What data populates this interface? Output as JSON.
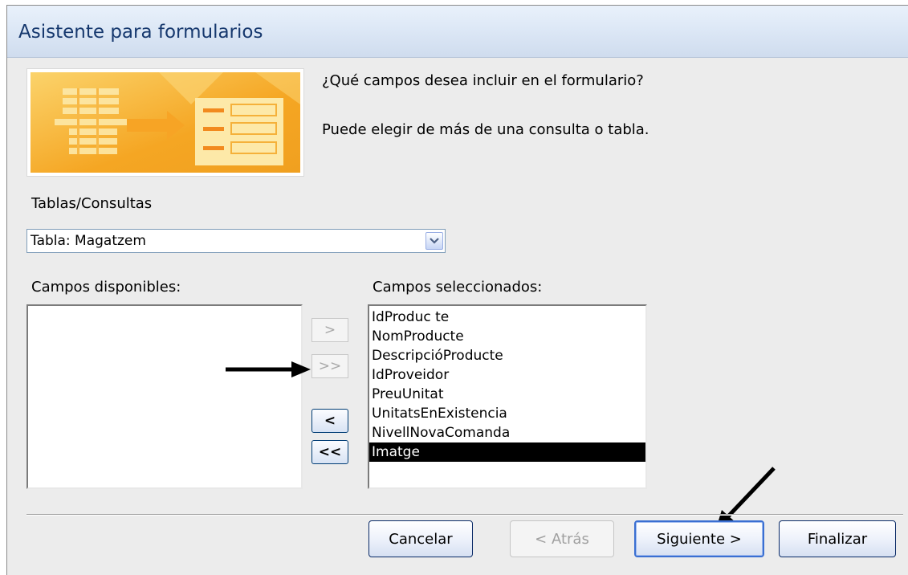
{
  "window": {
    "title": "Asistente para formularios"
  },
  "prompts": {
    "question": "¿Qué campos desea incluir en el formulario?",
    "hint": "Puede elegir de más de una consulta o tabla."
  },
  "tables_queries": {
    "label": "Tablas/Consultas",
    "selected": "Tabla: Magatzem"
  },
  "available_fields": {
    "label": "Campos disponibles:",
    "items": []
  },
  "selected_fields": {
    "label": "Campos seleccionados:",
    "items": [
      "IdProduc te",
      "NomProducte",
      "DescripcióProducte",
      "IdProveidor",
      "PreuUnitat",
      "UnitatsEnExistencia",
      "NivellNovaComanda",
      "Imatge"
    ],
    "highlighted": "Imatge"
  },
  "move_buttons": {
    "add_one": ">",
    "add_all": ">>",
    "remove_one": "<",
    "remove_all": "<<"
  },
  "footer": {
    "cancel": "Cancelar",
    "back": "< Atrás",
    "next": "Siguiente >",
    "finish": "Finalizar"
  },
  "colors": {
    "title_text": "#16386e",
    "accent_orange": "#f6b93b",
    "selection": "#000000"
  },
  "icons": {
    "combo_dropdown": "chevron-down-icon",
    "annotation": "arrow-icon"
  }
}
